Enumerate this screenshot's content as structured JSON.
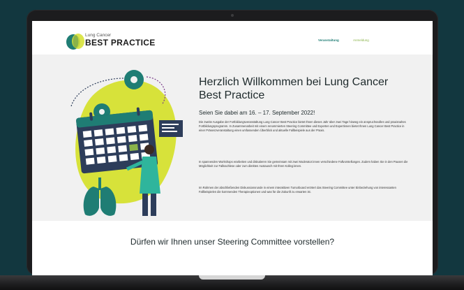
{
  "brand": {
    "small": "Lung Cancer",
    "name": "BEST PRACTICE",
    "colors": {
      "teal": "#1f7d74",
      "green": "#8ab34a",
      "yellow": "#d7e23a",
      "navy": "#2d3d5a"
    }
  },
  "nav": {
    "items": [
      "Veranstaltung",
      "Anmeldung"
    ]
  },
  "hero": {
    "title": "Herzlich Willkommen bei Lung Cancer Best Practice",
    "subtitle": "Seien Sie dabei am 16. – 17. September 2022!",
    "paragraphs": [
      "Die zweite Ausgabe der Fortbildungsveranstaltung Lung Cancer Best Practice bietet Ihnen dieses Jahr über zwei Tage hinweg ein anspruchsvolles und praxisnahes Fortbildungsprogramm. In Zusammenarbeit mit einem renommierten Steering Committee und Experten und Expertinnen bietet Ihnen Lung Cancer Best Practice in einer Präsenzveranstaltung einen umfassenden Überblick und aktuelle Fallbeispiele aus der Praxis.",
      "In spannenden Workshops erarbeiten und diskutieren Sie gemeinsam mit zwei Moderator:innen verschiedene Fallvorstellungen. Zudem haben Sie in den Pausen die Möglichkeit zur Fallnachlese oder zum direkten Austausch mit Ihren Kolleg:innen.",
      "Im Rahmen der abschließenden Diskussionsrunde in einem interaktiven Tumorboard erörtert das Steering Committee unter Einbeziehung von interessanten Fallbeispielen die kommenden Therapieoptionen und was für die Zukunft zu erwarten ist."
    ]
  },
  "section": {
    "title": "Dürfen wir Ihnen unser Steering Committee vorstellen?"
  }
}
